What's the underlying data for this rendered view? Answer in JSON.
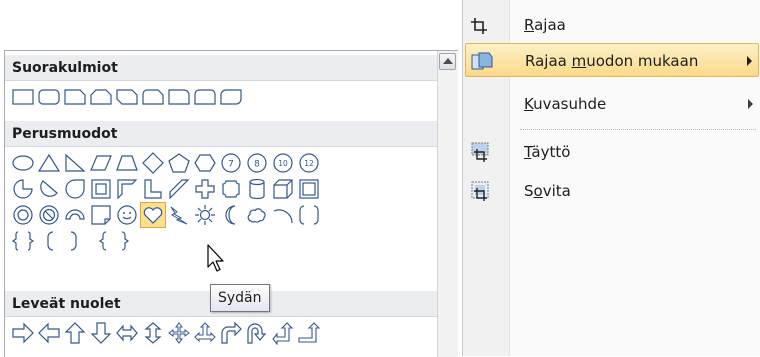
{
  "context_menu": {
    "items": [
      {
        "label_pre": "",
        "label_key": "R",
        "label_post": "ajaa",
        "icon": "crop-icon",
        "has_submenu": false,
        "highlighted": false
      },
      {
        "label_pre": "Rajaa ",
        "label_key": "m",
        "label_post": "uodon mukaan",
        "icon": "crop-to-shape-icon",
        "has_submenu": true,
        "highlighted": true
      },
      {
        "label_pre": "",
        "label_key": "K",
        "label_post": "uvasuhde",
        "icon": "",
        "has_submenu": true,
        "highlighted": false
      },
      {
        "label_pre": "",
        "label_key": "T",
        "label_post": "äyttö",
        "icon": "fill-icon",
        "has_submenu": false,
        "highlighted": false
      },
      {
        "label_pre": "S",
        "label_key": "o",
        "label_post": "vita",
        "icon": "fit-icon",
        "has_submenu": false,
        "highlighted": false
      }
    ]
  },
  "gallery": {
    "sections": [
      {
        "title": "Suorakulmiot"
      },
      {
        "title": "Perusmuodot"
      },
      {
        "title": "Leveät nuolet"
      }
    ],
    "rect_labels": [],
    "basic_labels": [
      "7",
      "8",
      "10",
      "12"
    ],
    "selected_shape": "heart-shape",
    "tooltip": "Sydän"
  },
  "colors": {
    "highlight_gradient_top": "#fdf1c6",
    "highlight_gradient_bottom": "#fbd98a",
    "shape_stroke": "#34578f",
    "section_header_bg": "#ebedf0"
  }
}
